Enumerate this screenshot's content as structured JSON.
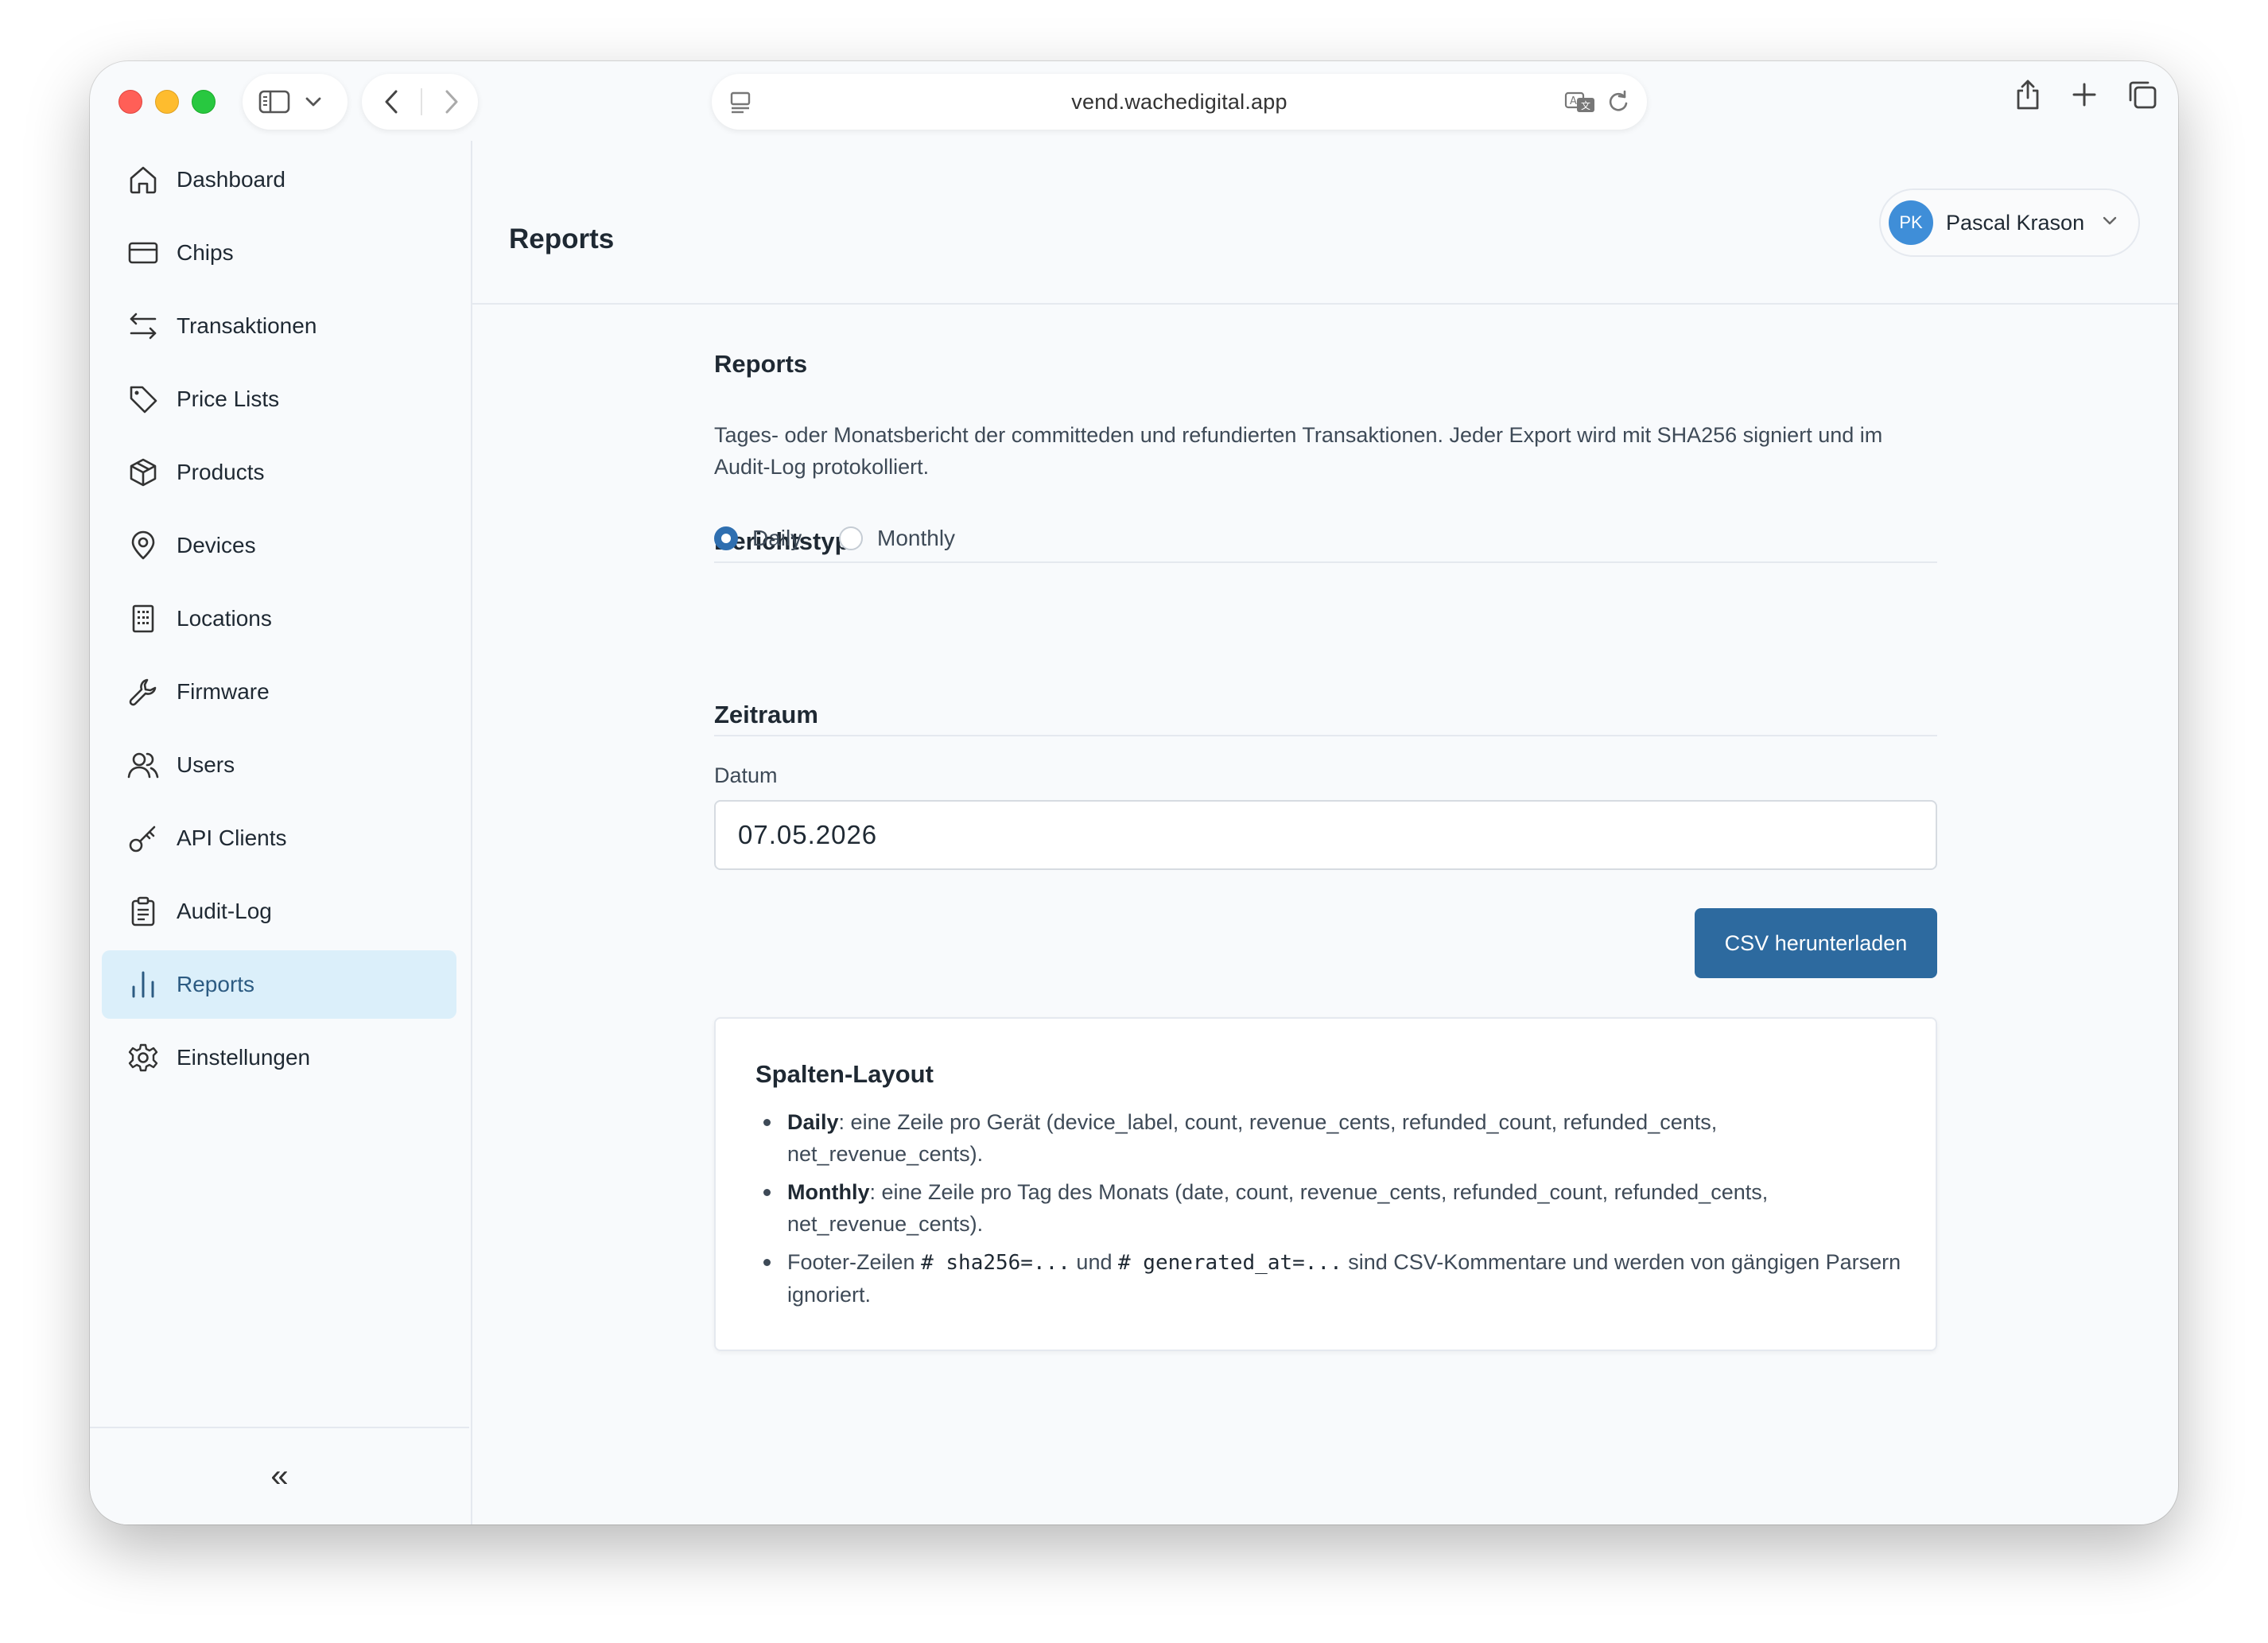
{
  "browser": {
    "url": "vend.wachedigital.app"
  },
  "sidebar": {
    "items": [
      {
        "label": "Dashboard",
        "icon": "home-icon"
      },
      {
        "label": "Chips",
        "icon": "card-icon"
      },
      {
        "label": "Transaktionen",
        "icon": "arrows-swap-icon"
      },
      {
        "label": "Price Lists",
        "icon": "tag-icon"
      },
      {
        "label": "Products",
        "icon": "box-icon"
      },
      {
        "label": "Devices",
        "icon": "map-pin-icon"
      },
      {
        "label": "Locations",
        "icon": "building-icon"
      },
      {
        "label": "Firmware",
        "icon": "wrench-icon"
      },
      {
        "label": "Users",
        "icon": "users-icon"
      },
      {
        "label": "API Clients",
        "icon": "key-icon"
      },
      {
        "label": "Audit-Log",
        "icon": "clipboard-icon"
      },
      {
        "label": "Reports",
        "icon": "bar-chart-icon",
        "active": true
      },
      {
        "label": "Einstellungen",
        "icon": "gear-icon"
      }
    ],
    "collapse_glyph": "«"
  },
  "header": {
    "title": "Reports",
    "user": {
      "initials": "PK",
      "name": "Pascal Krason"
    }
  },
  "main": {
    "title": "Reports",
    "description": "Tages- oder Monatsbericht der committeden und refundierten Transaktionen. Jeder Export wird mit SHA256 signiert und im Audit-Log protokolliert.",
    "report_type": {
      "heading": "Berichtstyp",
      "options": [
        "Daily",
        "Monthly"
      ],
      "selected": "Daily"
    },
    "period": {
      "heading": "Zeitraum",
      "date_label": "Datum",
      "date_value": "07.05.2026"
    },
    "download_button": "CSV herunterladen",
    "layout_card": {
      "title": "Spalten-Layout",
      "daily_term": "Daily",
      "daily_text": ": eine Zeile pro Gerät (device_label, count, revenue_cents, refunded_count, refunded_cents, net_revenue_cents).",
      "monthly_term": "Monthly",
      "monthly_text": ": eine Zeile pro Tag des Monats (date, count, revenue_cents, refunded_count, refunded_cents, net_revenue_cents).",
      "footer_prefix": "Footer-Zeilen ",
      "footer_code1": "# sha256=...",
      "footer_and": " und ",
      "footer_code2": "# generated_at=...",
      "footer_suffix": " sind CSV-Kommentare und werden von gängigen Parsern ignoriert."
    }
  },
  "colors": {
    "accent": "#2d6a9f",
    "active_nav_bg": "#dbeffa",
    "avatar": "#3f8ed8"
  }
}
